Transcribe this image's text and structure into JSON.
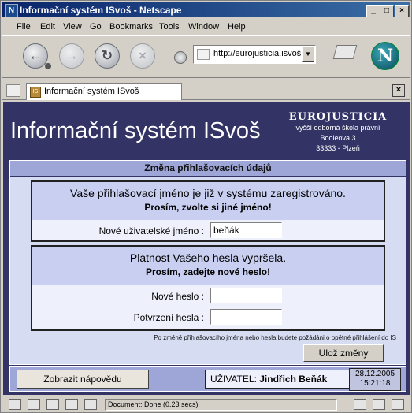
{
  "window": {
    "title": "Informační systém ISvoš - Netscape",
    "app_icon": "netscape-n-icon"
  },
  "menu": [
    "File",
    "Edit",
    "View",
    "Go",
    "Bookmarks",
    "Tools",
    "Window",
    "Help"
  ],
  "toolbar": {
    "url": "http://eurojusticia.isvoš"
  },
  "tab": {
    "label": "Informační systém ISvoš",
    "favicon": "IS"
  },
  "page": {
    "title": "Informační systém ISvoš",
    "school": {
      "name": "EUROJUSTICIA",
      "line1": "vyšší odborná škola právní",
      "line2": "Booleova 3",
      "line3": "33333 - Plzeň"
    },
    "panel_title": "Změna přihlašovacích údajů",
    "username_section": {
      "heading": "Vaše přihlašovací jméno je již v systému zaregistrováno.",
      "subheading": "Prosím, zvolte si jiné jméno!",
      "field_label": "Nové uživatelské jméno :",
      "field_value": "beňák"
    },
    "password_section": {
      "heading": "Platnost Vašeho hesla vypršela.",
      "subheading": "Prosím, zadejte nové heslo!",
      "new_label": "Nové heslo :",
      "confirm_label": "Potvrzení hesla :"
    },
    "note": "Po změně přihlašovacího jména nebo hesla budete požádáni o opětné přihlášení do IS",
    "save_button": "Ulož změny",
    "help_button": "Zobrazit nápovědu",
    "user_label": "UŽIVATEL:",
    "user_name": "Jindřich Beňák",
    "date": "28.12.2005",
    "time": "15:21:18"
  },
  "status": {
    "text": "Document: Done (0.23 secs)"
  }
}
